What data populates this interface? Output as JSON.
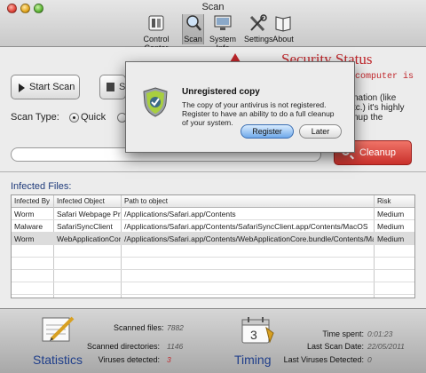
{
  "window": {
    "title": "Scan"
  },
  "toolbar": {
    "items": [
      {
        "label": "Control Center",
        "icon": "control-center-icon"
      },
      {
        "label": "Scan",
        "icon": "magnifier-icon",
        "active": true
      },
      {
        "label": "System Info",
        "icon": "monitor-icon"
      },
      {
        "label": "Settings",
        "icon": "tools-icon"
      },
      {
        "label": "About",
        "icon": "book-icon"
      }
    ]
  },
  "scan": {
    "start_label": "Start Scan",
    "stop_label": "S",
    "scan_type_label": "Scan Type:",
    "quick_label": "Quick",
    "cleanup_label": "Cleanup"
  },
  "status": {
    "title": "Security Status",
    "line1": "computer is",
    "line2": "nation (like",
    "line3": "tc.) it's highly",
    "line4": "nup the"
  },
  "infected": {
    "title": "Infected Files:",
    "columns": [
      "Infected By",
      "Infected Object",
      "Path to object",
      "Risk"
    ],
    "rows": [
      {
        "by": "Worm",
        "object": "Safari Webpage Pr...",
        "path": "/Applications/Safari.app/Contents",
        "risk": "Medium"
      },
      {
        "by": "Malware",
        "object": "SafariSyncClient",
        "path": "/Applications/Safari.app/Contents/SafariSyncClient.app/Contents/MacOS",
        "risk": "Medium"
      },
      {
        "by": "Worm",
        "object": "WebApplicationCore",
        "path": "/Applications/Safari.app/Contents/WebApplicationCore.bundle/Contents/MacOS",
        "risk": "Medium"
      }
    ]
  },
  "statistics": {
    "title": "Statistics",
    "scanned_files_label": "Scanned files:",
    "scanned_files": "7882",
    "scanned_dirs_label": "Scanned directories:",
    "scanned_dirs": "1146",
    "viruses_label": "Viruses detected:",
    "viruses": "3"
  },
  "timing": {
    "title": "Timing",
    "time_spent_label": "Time spent:",
    "time_spent": "0:01:23",
    "last_scan_label": "Last Scan Date:",
    "last_scan": "22/05/2011",
    "last_viruses_label": "Last Viruses Detected:",
    "last_viruses": "0",
    "calendar_day": "3"
  },
  "dialog": {
    "title": "Unregistered copy",
    "message": "The copy of your antivirus is not registered. Register to have an ability to do a full cleanup of your system.",
    "register_label": "Register",
    "later_label": "Later"
  },
  "colors": {
    "accent_red": "#c0262b",
    "title_blue": "#1f3e8a",
    "primary_button": "#6fa9ea"
  }
}
